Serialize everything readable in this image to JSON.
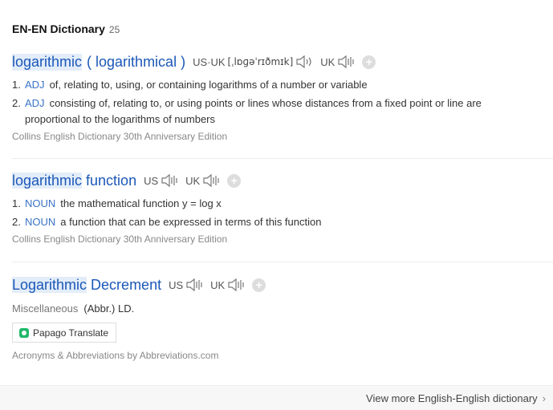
{
  "header": {
    "title": "EN-EN Dictionary",
    "count": "25"
  },
  "entries": [
    {
      "word": "logarithmic",
      "alt": "( logarithmical )",
      "us_label": "US·UK",
      "ipa": "[ˌlɒɡəˈrɪðmɪk]",
      "uk_label": "UK",
      "defs": [
        {
          "num": "1.",
          "pos": "ADJ",
          "text": "of, relating to, using, or containing logarithms of a number or variable"
        },
        {
          "num": "2.",
          "pos": "ADJ",
          "text": "consisting of, relating to, or using points or lines whose distances from a fixed point or line are proportional to the logarithms of numbers"
        }
      ],
      "source": "Collins English Dictionary 30th Anniversary Edition"
    },
    {
      "word": "logarithmic",
      "rest": " function",
      "us_label": "US",
      "uk_label": "UK",
      "defs": [
        {
          "num": "1.",
          "pos": "NOUN",
          "text": "the mathematical function y = log x"
        },
        {
          "num": "2.",
          "pos": "NOUN",
          "text": "a function that can be expressed in terms of this function"
        }
      ],
      "source": "Collins English Dictionary 30th Anniversary Edition"
    },
    {
      "word": "Logarithmic",
      "rest": " Decrement",
      "us_label": "US",
      "uk_label": "UK",
      "category": "Miscellaneous",
      "value": "(Abbr.) LD.",
      "papago": "Papago Translate",
      "source": "Acronyms & Abbreviations by Abbreviations.com"
    }
  ],
  "footer": {
    "more": "View more English-English dictionary"
  },
  "colors": {
    "link": "#1b58b8",
    "highlight": "#e3edf9",
    "pos": "#3a73c6",
    "papago": "#1fb86a"
  }
}
